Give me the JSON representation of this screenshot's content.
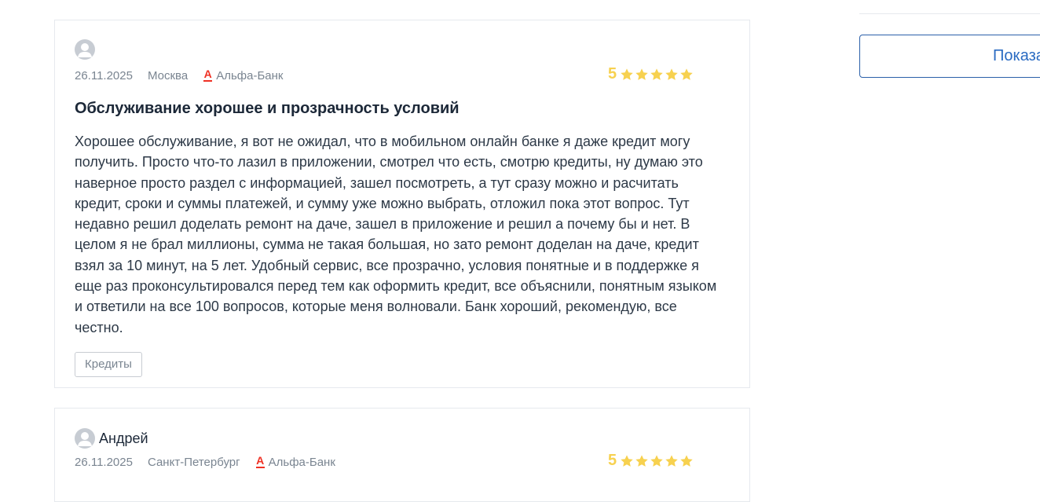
{
  "reviews": [
    {
      "author": "",
      "date": "26.11.2025",
      "city": "Москва",
      "bank": "Альфа-Банк",
      "rating": "5",
      "stars": 5,
      "title": "Обслуживание хорошее и прозрачность условий",
      "text": "Хорошее обслуживание, я вот не ожидал, что в мобильном онлайн банке я даже кредит могу получить. Просто что-то лазил в приложении, смотрел что есть, смотрю кредиты, ну думаю это наверное просто раздел с информацией, зашел посмотреть, а тут сразу можно и расчитать кредит, сроки и суммы платежей, и сумму уже можно выбрать, отложил пока этот вопрос. Тут недавно решил доделать ремонт на даче, зашел в приложение и решил а почему бы и нет. В целом я не брал миллионы, сумма не такая большая, но зато ремонт доделан на даче, кредит взял за 10 минут, на 5 лет. Удобный сервис, все прозрачно, условия понятные и в поддержке я еще раз проконсультировался перед тем как оформить кредит, все объяснили, понятным языком и ответили на все 100 вопросов, которые меня волновали. Банк хороший, рекомендую, все честно.",
      "tag": "Кредиты"
    },
    {
      "author": "Андрей",
      "date": "26.11.2025",
      "city": "Санкт-Петербург",
      "bank": "Альфа-Банк",
      "rating": "5",
      "stars": 5
    }
  ],
  "sidebar": {
    "show_more_label": "Показать"
  },
  "colors": {
    "star": "#f7d14f",
    "bank_brand": "#ef3124",
    "accent_blue": "#2a6bc2"
  },
  "icons": {
    "avatar": "user-avatar-icon",
    "bank": "alfa-bank-logo-icon",
    "star": "star-icon"
  }
}
